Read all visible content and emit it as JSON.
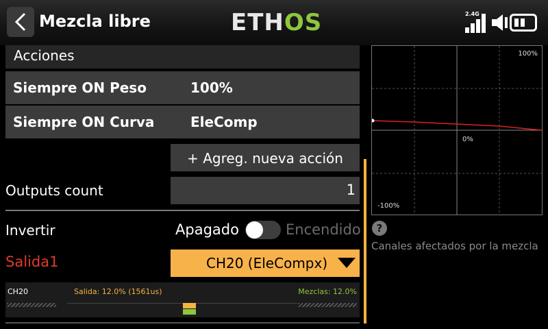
{
  "header": {
    "title": "Mezcla libre",
    "logo_left": "ETH",
    "logo_right": "OS",
    "rssi_label": "2.4G",
    "brand_green": "#8ec63f"
  },
  "actions": {
    "title": "Acciones",
    "rows": [
      {
        "label": "Siempre ON Peso",
        "value": "100%"
      },
      {
        "label": "Siempre ON Curva",
        "value": "EleComp"
      }
    ],
    "add_label": "+ Agreg. nueva acción"
  },
  "outputs": {
    "label": "Outputs count",
    "value": "1"
  },
  "invert": {
    "label": "Invertir",
    "off": "Apagado",
    "on": "Encendido",
    "state": false
  },
  "output1": {
    "label": "Salida1",
    "selected": "CH20 (EleCompx)",
    "accent": "#f8b24a",
    "label_color": "#e03a2a"
  },
  "monitor": {
    "channel": "CH20",
    "salida": "Salida: 12.0% (1561us)",
    "mezclas": "Mezclas: 12.0%",
    "output_percent": 12.0,
    "mix_percent": 12.0
  },
  "graph": {
    "label_top": "100%",
    "label_mid": "0%",
    "label_bottom": "-100%"
  },
  "help": {
    "icon": "question-icon",
    "text": "Canales afectados por la mezcla"
  }
}
